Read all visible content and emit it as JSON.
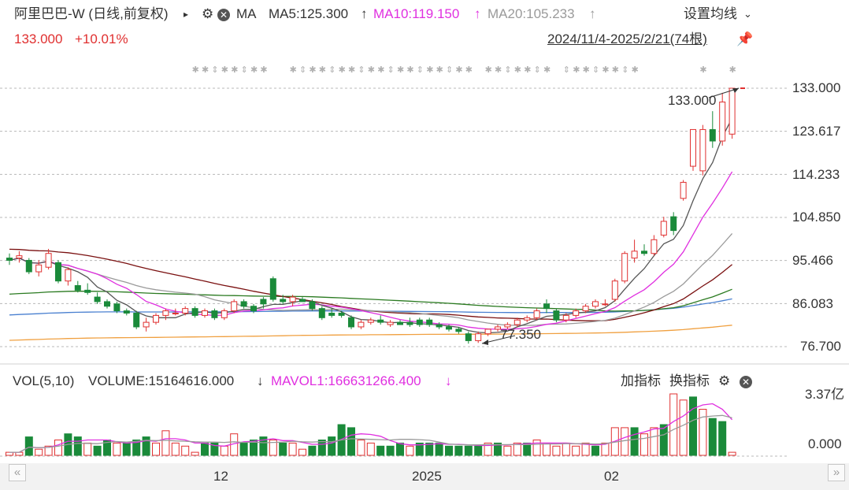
{
  "header": {
    "title": "阿里巴巴-W (日线,前复权)",
    "title_arrow": "▸",
    "indicator": "MA",
    "ma5": "MA5:125.300",
    "ma10": "MA10:119.150",
    "ma20": "MA20:105.233",
    "arrow_up": "↑",
    "settings_label": "设置均线",
    "price": "133.000",
    "change": "+10.01%",
    "date_range": "2024/11/4-2025/2/21(74根)"
  },
  "volume_panel": {
    "label": "VOL(5,10)",
    "volume": "VOLUME:15164616.000",
    "volume_arrow": "↓",
    "mavol1": "MAVOL1:166631266.400",
    "mavol1_arrow": "↓",
    "add_indicator": "加指标",
    "switch_indicator": "换指标"
  },
  "nav": {
    "left": "«",
    "right": "»"
  },
  "colors": {
    "up": "#e03030",
    "down": "#1a8a3a",
    "ma5": "#555555",
    "ma10": "#e030e0",
    "ma20": "#9a9a9a",
    "ma30": "#7a1010",
    "ma60": "#2a7a20",
    "ma120": "#4a80d0",
    "ma250": "#f0a040"
  },
  "chart_data": {
    "type": "candlestick",
    "price_axis": {
      "ticks": [
        "133.000",
        "123.617",
        "114.233",
        "104.850",
        "95.466",
        "86.083",
        "76.700"
      ],
      "range": [
        76.7,
        133.0
      ]
    },
    "volume_axis": {
      "ticks": [
        "3.37亿",
        "0.000"
      ]
    },
    "x_labels": [
      {
        "label": "12",
        "index": 22
      },
      {
        "label": "2025",
        "index": 42
      },
      {
        "label": "02",
        "index": 62
      }
    ],
    "annotations": {
      "high": "133.000",
      "low": "77.350"
    },
    "candles": [
      [
        96,
        97,
        94.5,
        95.5
      ],
      [
        96,
        97.5,
        95,
        96.5
      ],
      [
        95.5,
        96,
        92.5,
        93
      ],
      [
        93,
        95.5,
        92,
        94.5
      ],
      [
        94,
        98,
        93.5,
        97
      ],
      [
        95,
        95.5,
        90.5,
        91
      ],
      [
        91,
        94,
        90,
        93.5
      ],
      [
        90,
        91,
        88.5,
        89
      ],
      [
        89,
        90.5,
        88,
        88.5
      ],
      [
        87.5,
        88.5,
        86,
        86.5
      ],
      [
        86.5,
        87,
        85,
        85.5
      ],
      [
        86,
        86.5,
        84,
        84.5
      ],
      [
        84.5,
        85,
        83.5,
        84
      ],
      [
        84,
        84.5,
        80.5,
        81
      ],
      [
        81,
        83,
        80,
        82
      ],
      [
        82,
        84,
        81.5,
        83.5
      ],
      [
        83.5,
        85,
        82.5,
        84.5
      ],
      [
        84,
        85,
        83.5,
        84
      ],
      [
        84,
        85.5,
        83.5,
        85
      ],
      [
        85,
        85.5,
        83,
        83.5
      ],
      [
        83.5,
        85,
        83,
        84.5
      ],
      [
        84.5,
        85,
        82.5,
        83
      ],
      [
        83,
        85,
        82.5,
        84.5
      ],
      [
        84.5,
        87,
        84,
        86.5
      ],
      [
        86.5,
        87,
        85,
        85.5
      ],
      [
        85.5,
        86,
        84,
        84.5
      ],
      [
        87,
        87.5,
        85,
        86
      ],
      [
        91.5,
        92,
        86.5,
        87
      ],
      [
        87,
        88,
        86,
        86.5
      ],
      [
        86.5,
        88,
        85.5,
        87.5
      ],
      [
        87,
        87.5,
        86.5,
        86.5
      ],
      [
        86.5,
        87,
        84.5,
        85
      ],
      [
        85,
        85.5,
        82.5,
        83
      ],
      [
        84,
        85,
        83,
        83.5
      ],
      [
        84,
        84.5,
        83,
        83.5
      ],
      [
        83,
        83.5,
        80.5,
        81
      ],
      [
        81,
        82.5,
        80.5,
        82
      ],
      [
        82,
        83,
        81.5,
        82.5
      ],
      [
        82.5,
        83.5,
        81.5,
        82
      ],
      [
        81.5,
        82.5,
        81,
        82
      ],
      [
        82,
        82.5,
        81.5,
        81.5
      ],
      [
        82,
        83,
        81,
        81.5
      ],
      [
        82.5,
        83,
        81,
        81.5
      ],
      [
        82.5,
        83,
        81,
        81.5
      ],
      [
        81.5,
        82,
        80.5,
        81
      ],
      [
        81,
        81.5,
        80,
        80.5
      ],
      [
        80.5,
        81,
        79.5,
        80
      ],
      [
        79.5,
        80,
        77.35,
        78
      ],
      [
        78,
        80,
        77.5,
        79.5
      ],
      [
        79.5,
        80.5,
        79,
        80.5
      ],
      [
        80.5,
        81.5,
        80,
        81
      ],
      [
        81,
        82,
        80.5,
        81.5
      ],
      [
        81.5,
        83,
        81,
        82.5
      ],
      [
        82.5,
        83.5,
        82,
        83
      ],
      [
        83,
        85,
        82.5,
        84.5
      ],
      [
        86,
        87,
        84,
        85
      ],
      [
        84.5,
        85,
        82,
        82.5
      ],
      [
        82.5,
        84,
        82,
        83.5
      ],
      [
        83.5,
        85,
        83,
        84.5
      ],
      [
        84.5,
        86,
        84,
        85.5
      ],
      [
        85.5,
        87,
        85,
        86.5
      ],
      [
        86,
        87,
        85.5,
        86
      ],
      [
        87,
        91.5,
        86.5,
        91
      ],
      [
        91,
        97.5,
        90.5,
        97
      ],
      [
        96,
        100,
        95,
        97.5
      ],
      [
        97.5,
        99,
        96.5,
        97
      ],
      [
        97,
        101,
        96.5,
        100
      ],
      [
        101,
        105,
        100.5,
        104
      ],
      [
        105,
        106,
        101,
        102
      ],
      [
        109,
        113,
        108.5,
        112.5
      ],
      [
        116,
        124,
        115,
        124
      ],
      [
        115,
        125,
        114,
        124
      ],
      [
        124,
        128,
        120,
        121.5
      ],
      [
        121.5,
        132,
        120.5,
        130
      ],
      [
        123,
        133,
        122,
        133
      ]
    ],
    "volumes": [
      [
        0.05,
        1
      ],
      [
        0.05,
        1
      ],
      [
        0.3,
        0
      ],
      [
        0.1,
        1
      ],
      [
        0.15,
        1
      ],
      [
        0.25,
        1
      ],
      [
        0.35,
        0
      ],
      [
        0.3,
        0
      ],
      [
        0.2,
        1
      ],
      [
        0.15,
        0
      ],
      [
        0.25,
        0
      ],
      [
        0.2,
        1
      ],
      [
        0.2,
        0
      ],
      [
        0.25,
        0
      ],
      [
        0.3,
        0
      ],
      [
        0.2,
        1
      ],
      [
        0.4,
        1
      ],
      [
        0.2,
        1
      ],
      [
        0.15,
        1
      ],
      [
        0.05,
        1
      ],
      [
        0.2,
        0
      ],
      [
        0.2,
        0
      ],
      [
        0.15,
        1
      ],
      [
        0.35,
        1
      ],
      [
        0.2,
        0
      ],
      [
        0.25,
        0
      ],
      [
        0.3,
        0
      ],
      [
        0.25,
        1
      ],
      [
        0.2,
        0
      ],
      [
        0.2,
        1
      ],
      [
        0.1,
        1
      ],
      [
        0.15,
        0
      ],
      [
        0.25,
        0
      ],
      [
        0.3,
        0
      ],
      [
        0.5,
        0
      ],
      [
        0.45,
        0
      ],
      [
        0.25,
        1
      ],
      [
        0.2,
        1
      ],
      [
        0.15,
        0
      ],
      [
        0.15,
        0
      ],
      [
        0.2,
        0
      ],
      [
        0.15,
        1
      ],
      [
        0.2,
        0
      ],
      [
        0.2,
        0
      ],
      [
        0.2,
        0
      ],
      [
        0.15,
        0
      ],
      [
        0.15,
        0
      ],
      [
        0.15,
        0
      ],
      [
        0.15,
        0
      ],
      [
        0.2,
        1
      ],
      [
        0.2,
        0
      ],
      [
        0.15,
        1
      ],
      [
        0.2,
        1
      ],
      [
        0.2,
        0
      ],
      [
        0.25,
        1
      ],
      [
        0.2,
        1
      ],
      [
        0.15,
        1
      ],
      [
        0.2,
        1
      ],
      [
        0.15,
        1
      ],
      [
        0.2,
        1
      ],
      [
        0.15,
        0
      ],
      [
        0.2,
        1
      ],
      [
        0.45,
        1
      ],
      [
        0.45,
        1
      ],
      [
        0.45,
        0
      ],
      [
        0.35,
        1
      ],
      [
        0.45,
        1
      ],
      [
        0.5,
        0
      ],
      [
        1.0,
        1
      ],
      [
        0.9,
        1
      ],
      [
        0.95,
        0
      ],
      [
        0.75,
        1
      ],
      [
        0.6,
        0
      ],
      [
        0.55,
        0
      ],
      [
        0.05,
        1
      ]
    ]
  }
}
